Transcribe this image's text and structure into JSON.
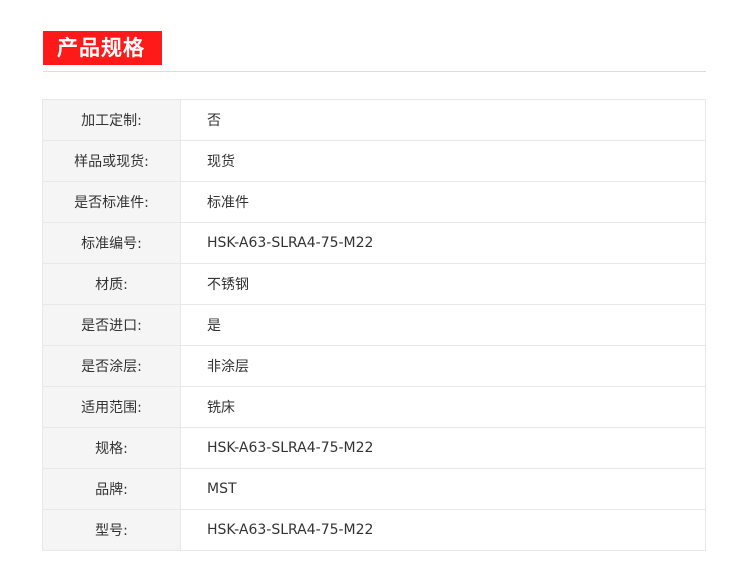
{
  "section": {
    "title": "产品规格"
  },
  "specs": [
    {
      "label": "加工定制:",
      "value": "否"
    },
    {
      "label": "样品或现货:",
      "value": "现货"
    },
    {
      "label": "是否标准件:",
      "value": "标准件"
    },
    {
      "label": "标准编号:",
      "value": "HSK-A63-SLRA4-75-M22"
    },
    {
      "label": "材质:",
      "value": "不锈钢"
    },
    {
      "label": "是否进口:",
      "value": "是"
    },
    {
      "label": "是否涂层:",
      "value": "非涂层"
    },
    {
      "label": "适用范围:",
      "value": "铣床"
    },
    {
      "label": "规格:",
      "value": "HSK-A63-SLRA4-75-M22"
    },
    {
      "label": "品牌:",
      "value": "MST"
    },
    {
      "label": "型号:",
      "value": "HSK-A63-SLRA4-75-M22"
    }
  ],
  "colors": {
    "accent": "#ff1a1a",
    "label_bg": "#f5f5f5",
    "border": "#e8e8e8"
  }
}
